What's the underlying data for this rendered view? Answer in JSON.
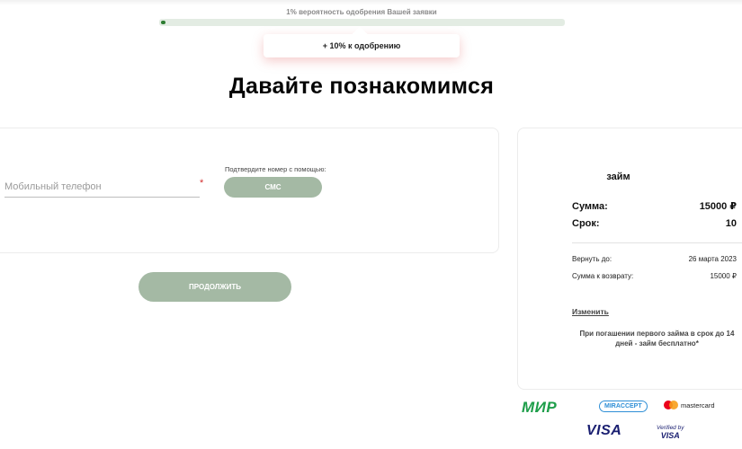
{
  "progress": {
    "text": "1% вероятность одобрения Вашей заявки",
    "value_percent": 1,
    "color": "#2e7d32",
    "tooltip": "+ 10% к одобрению"
  },
  "page": {
    "title": "Давайте познакомимся"
  },
  "form": {
    "phone_placeholder": "Мобильный телефон",
    "phone_value": "",
    "required_mark": "*",
    "confirm_label": "Подтвердите номер с помощью:",
    "sms_button": "СМС",
    "continue_button": "ПРОДОЛЖИТЬ",
    "button_color": "#a4b9a4"
  },
  "summary": {
    "title": "займ",
    "amount_label": "Сумма:",
    "amount_value": "15000 ₽",
    "term_label": "Срок:",
    "term_value": "10",
    "return_date_label": "Вернуть до:",
    "return_date_value": "26 марта 2023",
    "return_amount_label": "Сумма к возврату:",
    "return_amount_value": "15000 ₽",
    "edit_link": "Изменить",
    "note": "При погашении первого займа в срок до 14 дней - займ бесплатно*"
  },
  "payments": {
    "mir": "МИР",
    "mir_accept": "MIRACCEPT",
    "mastercard": "mastercard",
    "visa": "VISA",
    "verified_line1": "Verified by",
    "verified_line2": "VISA"
  }
}
